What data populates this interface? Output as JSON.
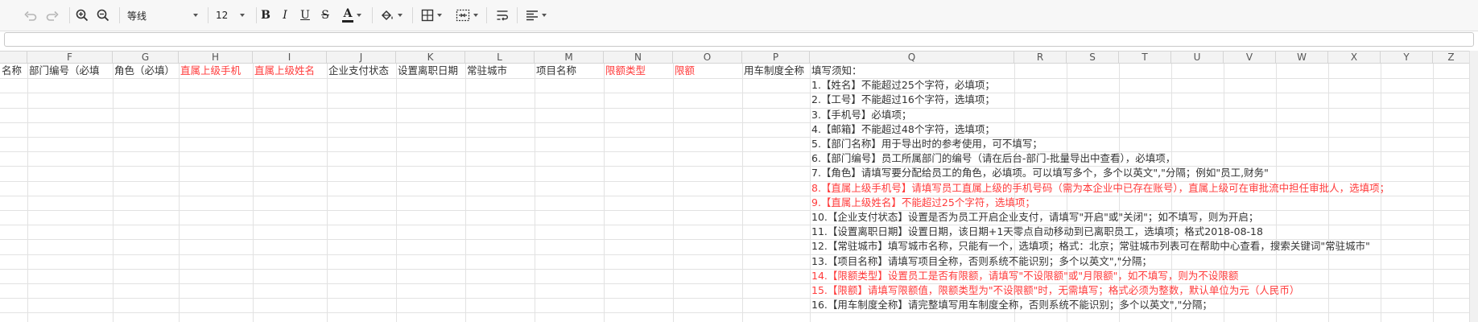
{
  "toolbar": {
    "font_name": "等线",
    "font_size": "12",
    "bold": "B",
    "italic": "I",
    "underline": "U",
    "strike": "S",
    "font_color": "A"
  },
  "columns": [
    "F",
    "G",
    "H",
    "I",
    "J",
    "K",
    "L",
    "M",
    "N",
    "O",
    "P",
    "Q",
    "R",
    "S",
    "T",
    "U",
    "V",
    "W",
    "X",
    "Y",
    "Z"
  ],
  "header_cells": {
    "e": "名称",
    "f": "部门编号（必填",
    "g": "角色（必填）",
    "h": "直属上级手机",
    "i": "直属上级姓名",
    "j": "企业支付状态",
    "k": "设置离职日期",
    "l": "常驻城市",
    "m": "项目名称",
    "n": "限额类型",
    "o": "限额",
    "p": "用车制度全称",
    "q": "填写须知："
  },
  "notes": [
    {
      "text": "1.【姓名】不能超过25个字符，必填项；",
      "red": false
    },
    {
      "text": "2.【工号】不能超过16个字符，选填项；",
      "red": false
    },
    {
      "text": "3.【手机号】必填项；",
      "red": false
    },
    {
      "text": "4.【邮箱】不能超过48个字符，选填项；",
      "red": false
    },
    {
      "text": "5.【部门名称】用于导出时的参考使用，可不填写；",
      "red": false
    },
    {
      "text": "6.【部门编号】员工所属部门的编号（请在后台-部门-批量导出中查看），必填项，",
      "red": false
    },
    {
      "text": "7.【角色】请填写要分配给员工的角色，必填项。可以填写多个，多个以英文\",\"分隔；例如\"员工,财务\"",
      "red": false
    },
    {
      "text": "8.【直属上级手机号】请填写员工直属上级的手机号码（需为本企业中已存在账号），直属上级可在审批流中担任审批人，选填项；",
      "red": true
    },
    {
      "text": "9.【直属上级姓名】不能超过25个字符，选填项；",
      "red": true
    },
    {
      "text": "10.【企业支付状态】设置是否为员工开启企业支付，请填写\"开启\"或\"关闭\"；如不填写，则为开启；",
      "red": false
    },
    {
      "text": "11.【设置离职日期】设置日期，该日期+1天零点自动移动到已离职员工，选填项；格式2018-08-18",
      "red": false
    },
    {
      "text": "12.【常驻城市】填写城市名称，只能有一个，选填项；格式：北京；常驻城市列表可在帮助中心查看，搜索关键词\"常驻城市\"",
      "red": false
    },
    {
      "text": "13.【项目名称】请填写项目全称，否则系统不能识别；多个以英文\",\"分隔；",
      "red": false
    },
    {
      "text": "14.【限额类型】设置员工是否有限额，请填写\"不设限额\"或\"月限额\"，如不填写，则为不设限额",
      "red": true
    },
    {
      "text": "15.【限额】请填写限额值，限额类型为\"不设限额\"时，无需填写；格式必须为整数，默认单位为元（人民币）",
      "red": true
    },
    {
      "text": "16.【用车制度全称】请完整填写用车制度全称，否则系统不能识别；多个以英文\",\"分隔；",
      "red": false
    }
  ]
}
